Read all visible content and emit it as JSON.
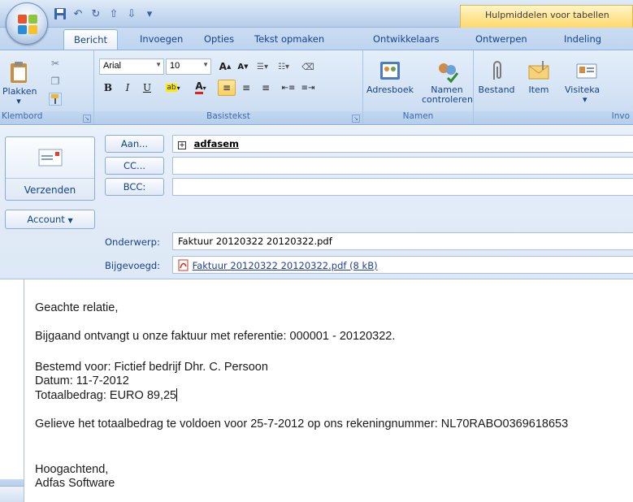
{
  "window": {
    "context_tab": "Hulpmiddelen voor tabellen"
  },
  "tabs": [
    "Bericht",
    "Invoegen",
    "Opties",
    "Tekst opmaken",
    "Ontwikkelaars",
    "Ontwerpen",
    "Indeling"
  ],
  "ribbon": {
    "clipboard": {
      "paste_label": "Plakken",
      "group_label": "Klembord"
    },
    "basic_text": {
      "font_name": "Arial",
      "font_size": "10",
      "group_label": "Basistekst",
      "buttons": [
        "B",
        "I",
        "U"
      ]
    },
    "names": {
      "addressbook_label": "Adresboek",
      "check_names_label_1": "Namen",
      "check_names_label_2": "controleren",
      "group_label": "Namen"
    },
    "include": {
      "file_label": "Bestand",
      "item_label": "Item",
      "card_label": "Visiteka",
      "group_label": "Invo"
    }
  },
  "header": {
    "send_label": "Verzenden",
    "account_label": "Account",
    "to_button": "Aan...",
    "cc_button": "CC...",
    "bcc_button": "BCC:",
    "to_expand": "+",
    "to_value": "adfasem",
    "cc_value": "",
    "bcc_value": "",
    "subject_label": "Onderwerp:",
    "subject_value": "Faktuur 20120322 20120322.pdf",
    "attached_label": "Bijgevoegd:",
    "attachment_value": "Faktuur 20120322 20120322.pdf (8 kB)"
  },
  "body": {
    "greeting": "Geachte relatie,",
    "line1": "Bijgaand ontvangt u onze faktuur met referentie: 000001 - 20120322.",
    "line2": "Bestemd voor: Fictief bedrijf Dhr. C. Persoon",
    "line3": "Datum: 11-7-2012",
    "line4": "Totaalbedrag: EURO 89,25",
    "line5": "Gelieve het totaalbedrag te voldoen voor 25-7-2012 op ons rekeningnummer: NL70RABO0369618653",
    "closing": "Hoogachtend,",
    "signature": "Adfas Software"
  },
  "colors": {
    "accent": "#15428b",
    "ribbon": "#d5e4f5",
    "context_tab": "#ffd86b"
  }
}
